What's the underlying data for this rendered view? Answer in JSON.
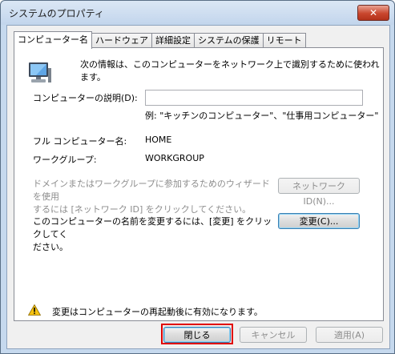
{
  "window": {
    "title": "システムのプロパティ",
    "close_label": "✕"
  },
  "tabs": [
    {
      "label": "コンピューター名",
      "active": true
    },
    {
      "label": "ハードウェア",
      "active": false
    },
    {
      "label": "詳細設定",
      "active": false
    },
    {
      "label": "システムの保護",
      "active": false
    },
    {
      "label": "リモート",
      "active": false
    }
  ],
  "panel": {
    "intro": "次の情報は、このコンピューターをネットワーク上で識別するために使われます。",
    "description_label": "コンピューターの説明(D):",
    "description_value": "",
    "example": "例: \"キッチンのコンピューター\"、\"仕事用コンピューター\"",
    "full_name_label": "フル コンピューター名:",
    "full_name_value": "HOME",
    "workgroup_label": "ワークグループ:",
    "workgroup_value": "WORKGROUP",
    "wizard_text_line1": "ドメインまたはワークグループに参加するためのウィザードを使用",
    "wizard_text_line2": "するには [ネットワーク ID] をクリックしてください。",
    "network_id_button": "ネットワーク ID(N)...",
    "rename_text_line1": "このコンピューターの名前を変更するには、[変更] をクリックしてく",
    "rename_text_line2": "ださい。",
    "change_button": "変更(C)...",
    "restart_notice": "変更はコンピューターの再起動後に有効になります。"
  },
  "footer": {
    "close_button": "閉じる",
    "cancel_button": "キャンセル",
    "apply_button": "適用(A)"
  },
  "colors": {
    "highlight": "#e00000",
    "title_bar": "#c6d9ee"
  }
}
